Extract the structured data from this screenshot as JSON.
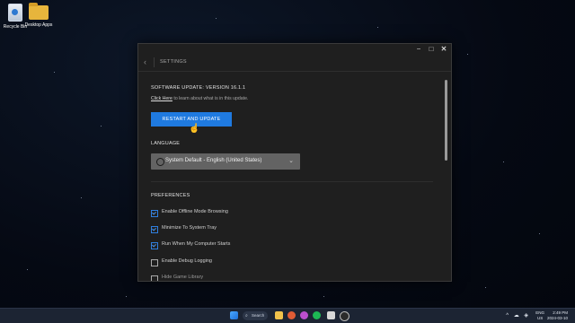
{
  "desktop": {
    "icons": [
      {
        "label": "Recycle Bin",
        "icon": "recycle-bin-icon"
      },
      {
        "label": "Desktop Apps",
        "icon": "folder-icon"
      }
    ]
  },
  "window": {
    "controls": {
      "minimize": "−",
      "maximize": "□",
      "close": "✕"
    },
    "header": {
      "back_icon": "‹",
      "title": "SETTINGS"
    },
    "update": {
      "title": "SOFTWARE UPDATE: VERSION 16.1.1",
      "note_link": "Click Here",
      "note_rest": " to learn about what is in this update.",
      "button_label": "RESTART AND UPDATE"
    },
    "language": {
      "title": "LANGUAGE",
      "selected": "System Default - English (United States)",
      "chevron": "⌄"
    },
    "preferences": {
      "title": "PREFERENCES",
      "options": [
        {
          "label": "Enable Offline Mode Browsing",
          "checked": true
        },
        {
          "label": "Minimize To System Tray",
          "checked": true
        },
        {
          "label": "Run When My Computer Starts",
          "checked": true
        },
        {
          "label": "Enable Debug Logging",
          "checked": false
        },
        {
          "label": "Hide Game Library",
          "checked": false
        }
      ]
    },
    "accent_color": "#1f7ae0"
  },
  "taskbar": {
    "search_label": "Search",
    "search_icon": "⌕",
    "tray_icons": "^ ☁ ◈",
    "lang_top": "ENG",
    "lang_bottom": "US",
    "time": "2:49 PM",
    "date": "2024-03-10"
  }
}
